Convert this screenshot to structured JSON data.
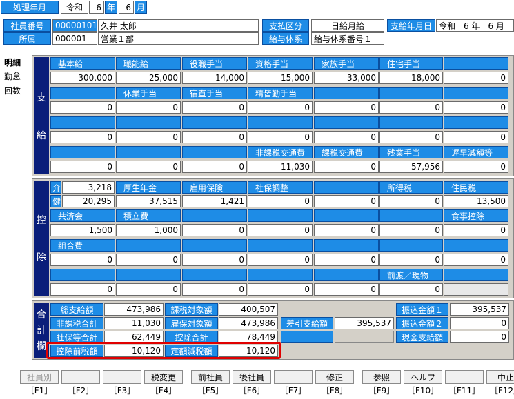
{
  "top": {
    "period_label": "処理年月",
    "era": "令和",
    "year": "6",
    "year_unit": "年",
    "month": "6",
    "month_unit": "月"
  },
  "employee": {
    "number_label": "社員番号",
    "number": "00000101",
    "name": "久井 太郎",
    "dept_label": "所属",
    "dept_code": "000001",
    "dept_name": "営業１部",
    "pay_type_label": "支払区分",
    "pay_type": "日給月給",
    "pay_system_label": "給与体系",
    "pay_system": "給与体系番号１",
    "pay_date_label": "支給年月日",
    "pay_date": "令和　6 年　6 月"
  },
  "tabs": [
    "明細",
    "勤怠",
    "回数"
  ],
  "payments": {
    "title_chars": [
      "支",
      "給"
    ],
    "rows": [
      {
        "headers": [
          "基本給",
          "職能給",
          "役職手当",
          "資格手当",
          "家族手当",
          "住宅手当",
          ""
        ],
        "values": [
          "300,000",
          "25,000",
          "14,000",
          "15,000",
          "33,000",
          "18,000",
          "0"
        ]
      },
      {
        "headers": [
          "",
          "休業手当",
          "宿直手当",
          "精皆勤手当",
          "",
          "",
          ""
        ],
        "values": [
          "0",
          "0",
          "0",
          "0",
          "0",
          "0",
          "0"
        ]
      },
      {
        "headers": [
          "",
          "",
          "",
          "",
          "",
          "",
          ""
        ],
        "values": [
          "0",
          "0",
          "0",
          "0",
          "0",
          "0",
          "0"
        ]
      },
      {
        "headers": [
          "",
          "",
          "",
          "非課税交通費",
          "課税交通費",
          "残業手当",
          "遅早減額等"
        ],
        "values": [
          "0",
          "0",
          "0",
          "11,030",
          "0",
          "57,956",
          "0"
        ]
      }
    ]
  },
  "deductions": {
    "title_chars": [
      "控",
      "除"
    ],
    "row1": {
      "kai_label": "介",
      "kai_value": "3,218",
      "ken_label": "健",
      "ken_value": "20,295",
      "headers": [
        "厚生年金",
        "雇用保険",
        "社保調整",
        "",
        "所得税",
        "住民税"
      ],
      "values": [
        "37,515",
        "1,421",
        "0",
        "0",
        "0",
        "13,500"
      ]
    },
    "rows": [
      {
        "headers": [
          "共済会",
          "積立費",
          "",
          "",
          "",
          "",
          "食事控除"
        ],
        "values": [
          "1,500",
          "1,000",
          "0",
          "0",
          "0",
          "0",
          "0"
        ]
      },
      {
        "headers": [
          "組合費",
          "",
          "",
          "",
          "",
          "",
          ""
        ],
        "values": [
          "0",
          "0",
          "0",
          "0",
          "0",
          "0",
          "0"
        ]
      },
      {
        "headers": [
          "",
          "",
          "",
          "",
          "",
          "前渡／現物",
          ""
        ],
        "values": [
          "0",
          "0",
          "0",
          "0",
          "0",
          "0",
          ""
        ]
      }
    ]
  },
  "totals": {
    "title_chars": [
      "合",
      "計",
      "欄"
    ],
    "total_pay_label": "総支給額",
    "total_pay": "473,986",
    "taxable_label": "課税対象額",
    "taxable": "400,507",
    "nontax_label": "非課税合計",
    "nontax": "11,030",
    "ins_target_label": "雇保対象額",
    "ins_target": "473,986",
    "net_label": "差引支給額",
    "net": "395,537",
    "social_label": "社保等合計",
    "social": "62,449",
    "ded_total_label": "控除合計",
    "ded_total": "78,449",
    "pre_tax_label": "控除前税額",
    "pre_tax": "10,120",
    "fixed_reduction_label": "定額減税額",
    "fixed_reduction": "10,120",
    "transfer1_label": "振込金額１",
    "transfer1": "395,537",
    "transfer2_label": "振込金額２",
    "transfer2": "0",
    "cash_label": "現金支給額",
    "cash": "0",
    "highlight_color": "#e00000"
  },
  "fkeys": [
    {
      "label": "社員別",
      "key": "［F1］",
      "enabled": false
    },
    {
      "label": "",
      "key": "［F2］",
      "enabled": false
    },
    {
      "label": "",
      "key": "［F3］",
      "enabled": false
    },
    {
      "label": "税変更",
      "key": "［F4］",
      "enabled": true
    },
    {
      "label": "前社員",
      "key": "［F5］",
      "enabled": true
    },
    {
      "label": "後社員",
      "key": "［F6］",
      "enabled": true
    },
    {
      "label": "",
      "key": "［F7］",
      "enabled": false
    },
    {
      "label": "修正",
      "key": "［F8］",
      "enabled": true
    },
    {
      "label": "参照",
      "key": "［F9］",
      "enabled": true
    },
    {
      "label": "ヘルプ",
      "key": "［F10］",
      "enabled": true
    },
    {
      "label": "",
      "key": "［F11］",
      "enabled": false
    },
    {
      "label": "中止",
      "key": "［F12］",
      "enabled": true
    }
  ]
}
